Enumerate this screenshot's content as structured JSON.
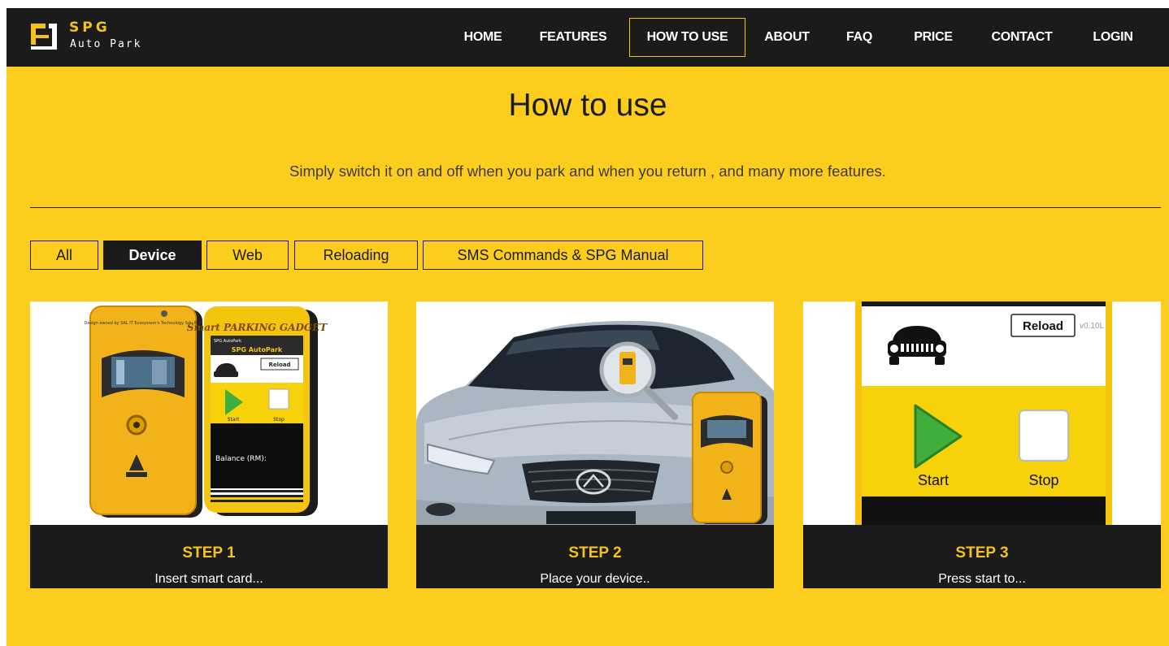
{
  "brand": {
    "name": "SPG",
    "tagline": "Auto Park",
    "accent": "#f4c21c",
    "bar": "#1b1b1b",
    "page_bg": "#fdcd1e"
  },
  "nav": {
    "items": [
      {
        "label": "HOME"
      },
      {
        "label": "FEATURES"
      },
      {
        "label": "HOW TO USE",
        "active": true
      },
      {
        "label": "ABOUT"
      },
      {
        "label": "FAQ"
      },
      {
        "label": "PRICE"
      },
      {
        "label": "CONTACT"
      },
      {
        "label": "LOGIN"
      }
    ]
  },
  "section": {
    "title": "How to use",
    "subtitle": "Simply switch it on and off when you park and when you return , and many more features."
  },
  "filters": [
    {
      "label": "All"
    },
    {
      "label": "Device",
      "active": true
    },
    {
      "label": "Web"
    },
    {
      "label": "Reloading"
    },
    {
      "label": "SMS Commands & SPG Manual"
    }
  ],
  "steps": [
    {
      "title": "STEP 1",
      "desc": "Insert smart card...",
      "image": {
        "device_text": "Design owned by SAL IT Ecosystem's Technology Sdn Bhd",
        "phone_header": "Smart PARKING GADGET",
        "phone_app": "SPG AutoPark",
        "phone_tab": "SPG AutoPark",
        "reload": "Reload",
        "start": "Start",
        "stop": "Stop",
        "balance": "Balance (RM):"
      }
    },
    {
      "title": "STEP 2",
      "desc": "Place your device.."
    },
    {
      "title": "STEP 3",
      "desc": "Press start to...",
      "image": {
        "reload": "Reload",
        "version": "v0.10L",
        "start": "Start",
        "stop": "Stop"
      }
    }
  ]
}
